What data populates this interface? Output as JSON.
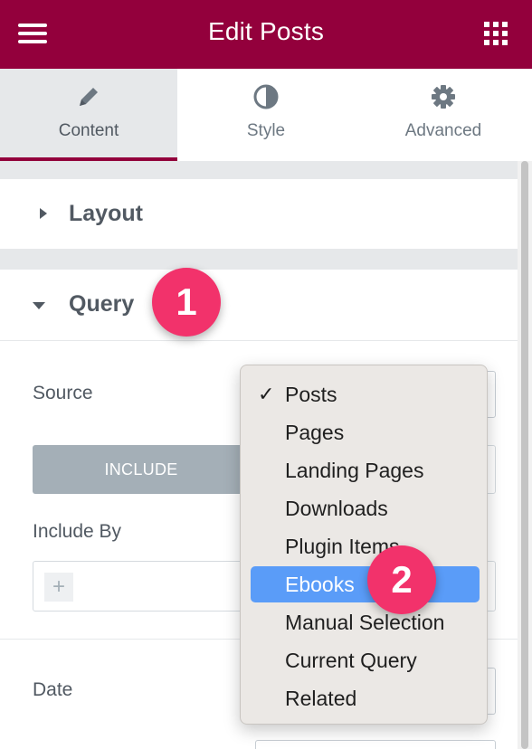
{
  "header": {
    "title": "Edit Posts",
    "menu_icon": "hamburger-icon",
    "apps_icon": "grid-icon"
  },
  "tabs": [
    {
      "label": "Content",
      "icon": "pencil-icon",
      "active": true
    },
    {
      "label": "Style",
      "icon": "half-circle-icon",
      "active": false
    },
    {
      "label": "Advanced",
      "icon": "gear-icon",
      "active": false
    }
  ],
  "sections": {
    "layout": {
      "title": "Layout",
      "expanded": false
    },
    "query": {
      "title": "Query",
      "expanded": true
    }
  },
  "query": {
    "source_label": "Source",
    "include_label": "INCLUDE",
    "include_by_label": "Include By",
    "add_symbol": "+",
    "date_label": "Date"
  },
  "dropdown": {
    "checkmark": "✓",
    "options": [
      "Posts",
      "Pages",
      "Landing Pages",
      "Downloads",
      "Plugin Items",
      "Ebooks",
      "Manual Selection",
      "Current Query",
      "Related"
    ],
    "selected": "Posts",
    "highlighted": "Ebooks"
  },
  "annotations": {
    "badge_1": "1",
    "badge_2": "2"
  },
  "colors": {
    "brand": "#93003c",
    "badge": "#f2326b",
    "highlight": "#5a9cf8",
    "muted": "#a4afb7",
    "text": "#515962"
  }
}
